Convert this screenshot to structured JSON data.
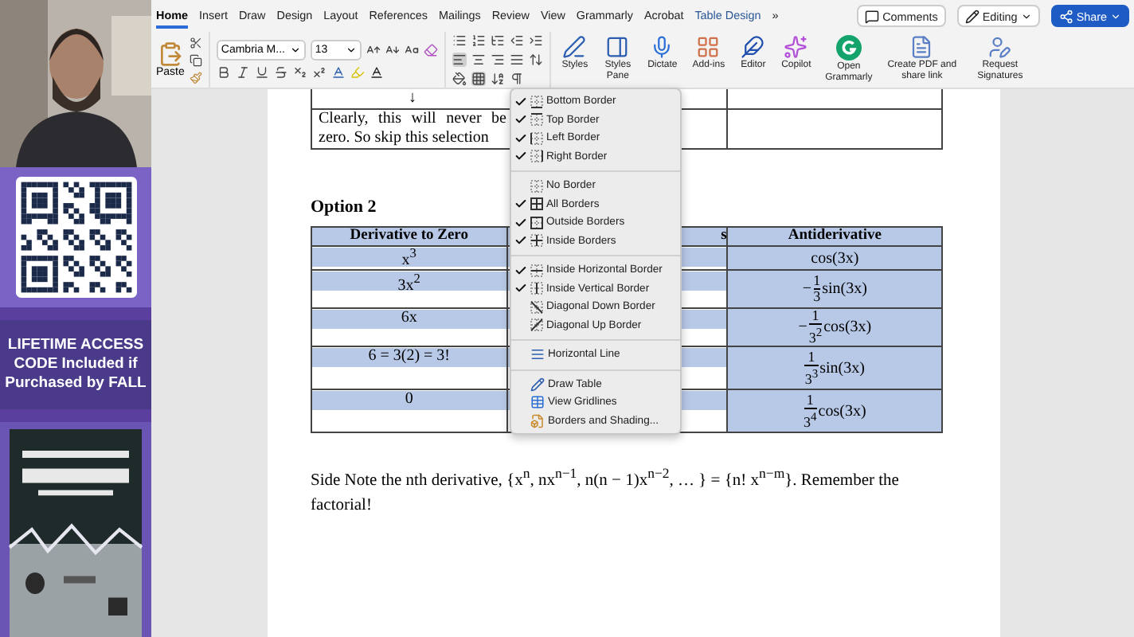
{
  "promo": {
    "banner": "LIFETIME ACCESS CODE Included if Purchased by FALL"
  },
  "tabs": [
    {
      "label": "Home",
      "selected": true
    },
    {
      "label": "Insert",
      "selected": false
    },
    {
      "label": "Draw",
      "selected": false
    },
    {
      "label": "Design",
      "selected": false
    },
    {
      "label": "Layout",
      "selected": false
    },
    {
      "label": "References",
      "selected": false
    },
    {
      "label": "Mailings",
      "selected": false
    },
    {
      "label": "Review",
      "selected": false
    },
    {
      "label": "View",
      "selected": false
    },
    {
      "label": "Grammarly",
      "selected": false
    },
    {
      "label": "Acrobat",
      "selected": false
    },
    {
      "label": "Table Design",
      "selected": false
    }
  ],
  "tab_overflow": "»",
  "top_buttons": [
    {
      "kind": "comments",
      "label": "Comments"
    },
    {
      "kind": "editing",
      "label": "Editing"
    },
    {
      "kind": "share",
      "label": "Share"
    }
  ],
  "ribbon": {
    "paste": "Paste",
    "font": "Cambria M...",
    "size": "13",
    "large_buttons": [
      {
        "kind": "styles",
        "label": "Styles"
      },
      {
        "kind": "pane",
        "label": "Styles Pane"
      },
      {
        "kind": "dictate",
        "label": "Dictate"
      },
      {
        "kind": "addins",
        "label": "Add-ins"
      },
      {
        "kind": "editor",
        "label": "Editor"
      },
      {
        "kind": "copilot",
        "label": "Copilot"
      },
      {
        "kind": "grammarly",
        "label": "Open Grammarly"
      },
      {
        "kind": "pdf",
        "label": "Create PDF and share link"
      },
      {
        "kind": "sign",
        "label": "Request Signatures"
      }
    ]
  },
  "document": {
    "top_table": [
      {
        "cells": [
          "↓",
          ""
        ]
      },
      {
        "cells": [
          "Clearly, this will never be zero. So skip this selection",
          ""
        ]
      }
    ],
    "heading": "Option 2",
    "table": {
      "columns": [
        "Derivative to Zero",
        "s",
        "Antiderivative"
      ],
      "rows": [
        {
          "selected": true,
          "derivative": "x$^{3}$",
          "anti": {
            "kind": "plain",
            "text": "cos(3x)"
          }
        },
        {
          "selected": true,
          "derivative": "3x$^{2}$",
          "anti": {
            "kind": "fraction",
            "sign": "−",
            "num": "1",
            "den": "3",
            "tail": "sin(3x)"
          }
        },
        {
          "selected": true,
          "derivative": "6x",
          "anti": {
            "kind": "fraction",
            "sign": "−",
            "num": "1",
            "den": "3$^{2}$",
            "tail": "cos(3x)"
          }
        },
        {
          "selected": true,
          "derivative": "6 = 3(2) = 3!",
          "anti": {
            "kind": "fraction",
            "num": "1",
            "den": "3$^{3}$",
            "tail": "sin(3x)"
          }
        },
        {
          "selected": true,
          "derivative": "0",
          "anti": {
            "kind": "fraction",
            "num": "1",
            "den": "3$^{4}$",
            "tail": "cos(3x)"
          }
        }
      ]
    },
    "note": "Side Note the nth derivative, {x$^{n}$, nx$^{n−1}$,  n(n − 1)x$^{n−2}$, … } = {n! x$^{n−m}$}. Remember the factorial!"
  },
  "borders_menu": {
    "groups": [
      [
        {
          "kind": "toggle",
          "label": "Bottom Border",
          "checked": true
        },
        {
          "kind": "toggle",
          "label": "Top Border",
          "checked": true
        },
        {
          "kind": "toggle",
          "label": "Left Border",
          "checked": true
        },
        {
          "kind": "toggle",
          "label": "Right Border",
          "checked": true
        }
      ],
      [
        {
          "kind": "toggle",
          "label": "No Border",
          "checked": false
        },
        {
          "kind": "toggle",
          "label": "All Borders",
          "checked": true
        },
        {
          "kind": "toggle",
          "label": "Outside Borders",
          "checked": true
        },
        {
          "kind": "toggle",
          "label": "Inside Borders",
          "checked": true
        }
      ],
      [
        {
          "kind": "toggle",
          "label": "Inside Horizontal Border",
          "checked": true
        },
        {
          "kind": "toggle",
          "label": "Inside Vertical Border",
          "checked": true
        },
        {
          "kind": "toggle",
          "label": "Diagonal Down Border",
          "checked": false
        },
        {
          "kind": "toggle",
          "label": "Diagonal Up Border",
          "checked": false
        }
      ],
      [
        {
          "kind": "hline",
          "label": "Horizontal Line"
        }
      ],
      [
        {
          "kind": "draw",
          "label": "Draw Table"
        },
        {
          "kind": "grid",
          "label": "View Gridlines"
        },
        {
          "kind": "shading",
          "label": "Borders and Shading..."
        }
      ]
    ]
  }
}
